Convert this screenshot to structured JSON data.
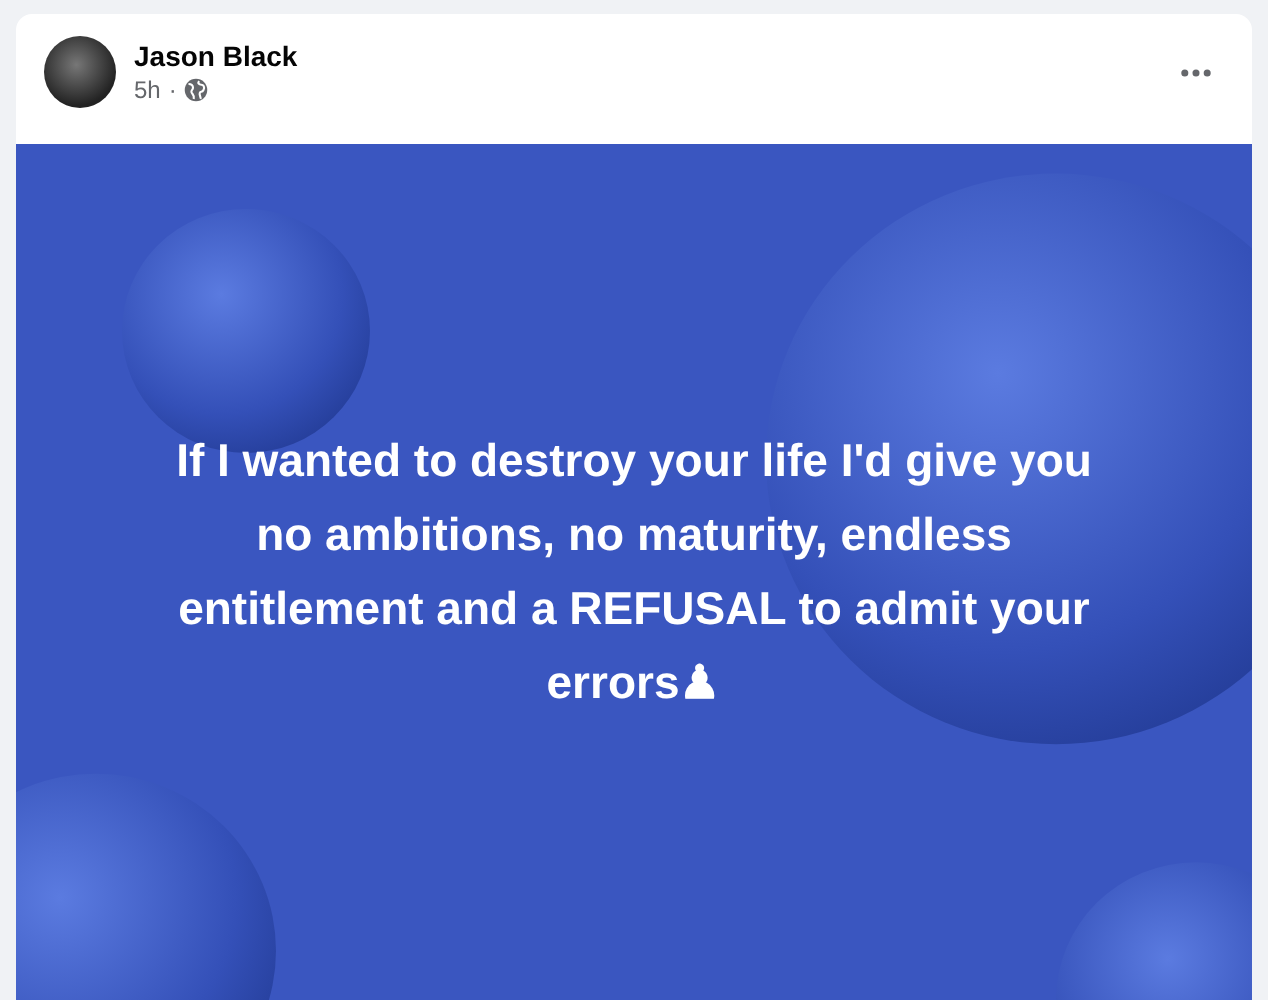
{
  "post": {
    "author": "Jason Black",
    "time": "5h",
    "separator": "·",
    "public": true
  },
  "background_text": "If I wanted to destroy your life I'd give you no ambitions, no maturity, endless entitlement and a REFUSAL to admit your errors♟"
}
